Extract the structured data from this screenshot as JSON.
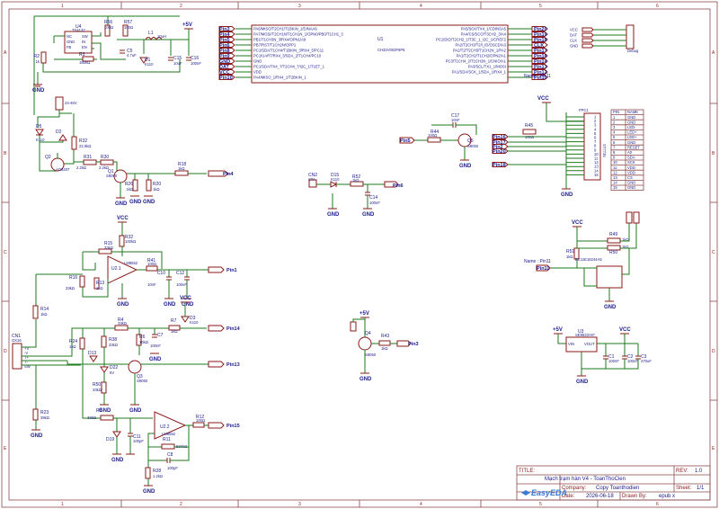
{
  "frame": {
    "col_labels": [
      "1",
      "2",
      "3",
      "4",
      "5",
      "6"
    ],
    "row_labels": [
      "A",
      "B",
      "C",
      "D",
      "E"
    ]
  },
  "title_block": {
    "title_label": "TITLE:",
    "title": "Mạch trạm hàn V4 - ToanThoCien",
    "rev_label": "REV:",
    "rev": "1.0",
    "company_label": "Company:",
    "company": "Copy Toanthodien",
    "sheet_label": "Sheet:",
    "sheet": "1/1",
    "date_label": "Date:",
    "date": "2026-06-18",
    "drawn_label": "Drawn By:",
    "drawn": "epub x",
    "logo_text": "EasyEDA"
  },
  "power_labels": {
    "p5v_top": "+5V",
    "vcc_mcu": "VCC",
    "vcc_opamp": "VCC",
    "vcc_mid": "VCC",
    "vcc_lcd": "VCC",
    "vcc_eeprom": "VCC",
    "p5v_q4": "+5V",
    "p5v_reg": "+5V",
    "vcc_reg": "VCC",
    "gnd": "GND"
  },
  "buck": {
    "u4_ref": "U4",
    "u4_part": "TS4137",
    "u4_pins": [
      "FB",
      "SW",
      "GND",
      "IN",
      "NC",
      "EN"
    ],
    "r2": "R2",
    "r2_val": "1k",
    "r3": "R3",
    "r3_val": "180kΩ",
    "r56": "R56",
    "r56_val": "100Ω",
    "r57": "R57",
    "r57_val": "100Ω",
    "l1": "L1",
    "l1_val": "10uH",
    "c5": "C5",
    "c5_val": "4.7uF",
    "d1": "D1",
    "d1_val": "K110",
    "c15": "C15",
    "c15_val": "10uF",
    "c16": "C16",
    "c16_val": "100nF"
  },
  "mcu": {
    "ref": "U1",
    "part": "CH32V003F6P6",
    "left_pins": [
      "PA6/MISO/T2CH1/T1BKIN_1/DINAA6",
      "PA7/MOSI/T2CH1N/T1CH1N_1/OPN0/PB0/T1CH1_3",
      "PB1/T1CH3N_3/RX4/OPN1/A9",
      "PB7/RST/T1CH2N/OPP1",
      "PC1/SDA/T1CH4/T1BKIN_3/RX4_5/PC11",
      "PC1/UART/RX4_3/SDA_2/T1CH4/PC10",
      "GND",
      "PC1/SDA/TX4_7/T2CH4_7/I2C_1/T1ET_1",
      "VDD",
      "PA4/MISO_1/RX4_1/T2BKIN_1"
    ],
    "right_pins": [
      "PA5/SCK/TX4_1/CDINSA5",
      "PA4/CS/SCO/T3CH2_3/A4",
      "PC1/DIO/T2CH2_1/T3C_1_I2C_1/CREF2",
      "PA2/T2CH3/T2/I_ID/OSCD/A3",
      "PA2/T2/T2CH3/T1CH2N_1/PA2",
      "PA1/T2CH2/T1CH2/OPN2/A1",
      "PC3/T1CH4_2/T1CH2N_1/CNIO/A1",
      "PA3/SCL/TX1_1/MOSI",
      "PA1/SDA/SCK_1/SDA_1/RX4_1"
    ],
    "left_nets": [
      "Pin3",
      "Pin4",
      "Pin5",
      "Pin6",
      "Pin8",
      "Pin9",
      "GND",
      "DAT",
      "VCC",
      "Pin10"
    ],
    "right_nets": [
      "Pin20",
      "Pin19",
      "Pin18",
      "CLK",
      "Pin17",
      "Pin16",
      "Pin14",
      "Pin13",
      "Pin12",
      "Pin11"
    ],
    "name_label": "Name : Pin11"
  },
  "header_prog": {
    "ref": "H1",
    "label": "Debug",
    "nets": [
      "VCC",
      "DAT",
      "CLK",
      "GND"
    ]
  },
  "lcd": {
    "ref": "FPC1",
    "part": "ST7735",
    "table_header": [
      "PIN",
      "NAME"
    ],
    "rows": [
      [
        "1",
        "GND"
      ],
      [
        "2",
        "GND"
      ],
      [
        "3",
        "LED-"
      ],
      [
        "4",
        "LED+"
      ],
      [
        "5",
        "LED+"
      ],
      [
        "6",
        "GND"
      ],
      [
        "7",
        "RESET"
      ],
      [
        "8",
        "A0"
      ],
      [
        "9",
        "SDA"
      ],
      [
        "10",
        "SCK"
      ],
      [
        "11",
        "VDD"
      ],
      [
        "12",
        "VDD"
      ],
      [
        "13",
        "CS"
      ],
      [
        "14",
        "GND"
      ],
      [
        "15",
        "GND"
      ]
    ],
    "r45": "R45",
    "r45_val": "100Ω",
    "nets": [
      "Pin16",
      "Pin17",
      "Pin2",
      "Pin20",
      "Pin18"
    ]
  },
  "q5_stage": {
    "c17": "C17",
    "c17_val": "10nF",
    "r44": "R44",
    "r44_val": "100Ω",
    "q5": "Q5",
    "q5_part": "S8050",
    "in_net": "Pin5"
  },
  "power_switch": {
    "header": "H2",
    "header_label": "24-48V",
    "d5": "D5",
    "d5_val": "K110",
    "d2": "D2",
    "r32": "R32",
    "r32_val": "22.0kΩ",
    "r31": "R31",
    "r31_val": "2.2kΩ",
    "r30": "R30",
    "r30_val": "2.2kΩ",
    "q2": "Q2",
    "q2_part": "AO3407",
    "q1": "Q1",
    "q1_part": "S8050",
    "r18": "R18",
    "r18_val": "1kΩ",
    "r26": "R26",
    "r26_val": "1kΩ",
    "r20": "R20",
    "r20_val": "1kΩ",
    "out_net": "Pin4"
  },
  "sense_switch": {
    "cn2": "CN2",
    "cn2_label": "STA",
    "d15": "D15",
    "d15_val": "K110",
    "r52": "R52",
    "r52_val": "1kΩ",
    "c14": "C14",
    "c14_val": "100nF",
    "out_net": "Pin6"
  },
  "opamp1": {
    "ref": "U2.1",
    "part": "LM8552",
    "r15": "R15",
    "r15_val": "33kΩ",
    "r32b": "R32",
    "r32b_val": "100kΩ",
    "r41": "R41",
    "r41_val": "100Ω",
    "r16": "R16",
    "r16_val": "33kΩ",
    "r13": "R13",
    "r13_val": "1kΩ",
    "c10": "C10",
    "c10_val": "10nF",
    "c12": "C12",
    "c12_val": "100nF",
    "out_net": "Pin1"
  },
  "opamp2": {
    "ref": "U2.2",
    "part": "LM8552",
    "r8": "R8",
    "r8_val": "33kΩ",
    "r11": "R11",
    "r11_val": "560kΩ",
    "r12": "R12",
    "r12_val": "100Ω",
    "c11": "C11",
    "c11_val": "100pF",
    "c8": "C8",
    "c8_val": "100pF",
    "r28": "R28",
    "r28_val": "1.2kΩ",
    "d19": "D19",
    "out_net": "Pin15"
  },
  "thermo": {
    "cn1": "CN1",
    "cn1_label": "GX16",
    "cn1_pins": [
      "+V",
      "-V",
      "T+",
      "T-",
      "SW"
    ],
    "r14": "R14",
    "r14_val": "1kΩ",
    "r23": "R23",
    "r23_val": "39kΩ",
    "r24": "R24",
    "r24_val": "1kΩ",
    "d13": "D13",
    "d22": "D22",
    "d22_val": "6V",
    "r4": "R4",
    "r4_val": "33kΩ",
    "r38": "R38",
    "r38_val": "33kΩ",
    "r50": "R50",
    "r50_val": "33kΩ",
    "r6": "R6",
    "r6_val": "10kΩ",
    "c7": "C7",
    "c7_val": "100nF",
    "r7": "R7",
    "r7_val": "1kΩ",
    "d3": "D3",
    "d3_val": "K110",
    "q3": "Q3",
    "q3_part": "S8050",
    "out_nets": [
      "Pin14",
      "Pin13"
    ]
  },
  "q4_stage": {
    "q4": "Q4",
    "q4_part": "S8050",
    "r43": "R43",
    "r43_val": "1kΩ",
    "in_net": "Pin3"
  },
  "eeprom": {
    "r49": "R49",
    "r49_val": "1kΩ",
    "r50b": "R50",
    "r50b_val": "1kΩ",
    "r51": "R51",
    "r51_val": "1kΩ",
    "u6": "U6",
    "u6_part": "EC11E18244A5",
    "name_label": "Name : Pin11",
    "net": "Pin11"
  },
  "regulator": {
    "u3": "U3",
    "u3_part": "SE8533-HF",
    "vin": "VIN",
    "vout": "VOUT",
    "c1": "C1",
    "c1_val": "100nF",
    "c2": "C2",
    "c2_val": "100nF",
    "c3": "C3",
    "c3_val": "470uF"
  }
}
